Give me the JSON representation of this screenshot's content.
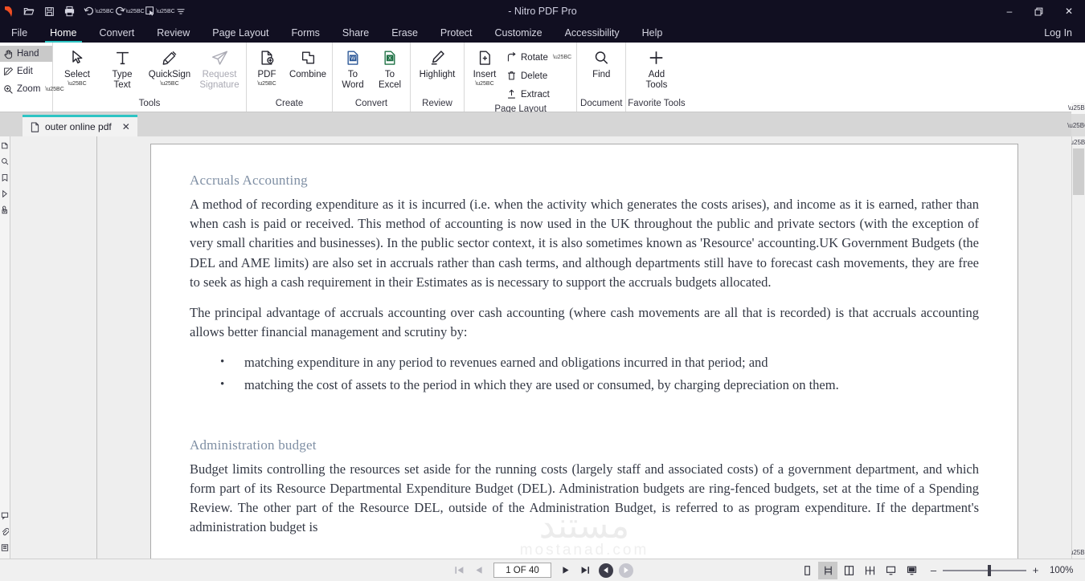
{
  "window": {
    "title": "- Nitro PDF Pro",
    "controls": {
      "minimize": "–",
      "restore": "❐",
      "close": "✕"
    },
    "quick_access": [
      "open-icon",
      "save-icon",
      "print-icon",
      "undo-icon",
      "redo-icon",
      "tool-icon",
      "customize-qat-icon"
    ]
  },
  "menubar": {
    "items": [
      {
        "label": "File",
        "active": false
      },
      {
        "label": "Home",
        "active": true
      },
      {
        "label": "Convert",
        "active": false
      },
      {
        "label": "Review",
        "active": false
      },
      {
        "label": "Page Layout",
        "active": false
      },
      {
        "label": "Forms",
        "active": false
      },
      {
        "label": "Share",
        "active": false
      },
      {
        "label": "Erase",
        "active": false
      },
      {
        "label": "Protect",
        "active": false
      },
      {
        "label": "Customize",
        "active": false
      },
      {
        "label": "Accessibility",
        "active": false
      },
      {
        "label": "Help",
        "active": false
      }
    ],
    "login_label": "Log In"
  },
  "ribbon": {
    "modes": [
      {
        "label": "Hand",
        "selected": true
      },
      {
        "label": "Edit",
        "selected": false
      },
      {
        "label": "Zoom",
        "selected": false,
        "dropdown": true
      }
    ],
    "groups": [
      {
        "label": "Tools",
        "buttons": [
          {
            "label": "Select",
            "dropdown": true,
            "disabled": false
          },
          {
            "label": "Type\nText",
            "line1": "Type",
            "line2": "Text",
            "dropdown": false,
            "disabled": false
          },
          {
            "label": "QuickSign",
            "dropdown": true,
            "disabled": false
          },
          {
            "label": "Request Signature",
            "line1": "Request",
            "line2": "Signature",
            "dropdown": false,
            "disabled": true
          }
        ]
      },
      {
        "label": "Create",
        "buttons": [
          {
            "label": "PDF",
            "dropdown": true,
            "disabled": false
          },
          {
            "label": "Combine",
            "dropdown": false,
            "disabled": false
          }
        ]
      },
      {
        "label": "Convert",
        "buttons": [
          {
            "label": "To Word",
            "line1": "To",
            "line2": "Word",
            "dropdown": false,
            "disabled": false
          },
          {
            "label": "To Excel",
            "line1": "To",
            "line2": "Excel",
            "dropdown": false,
            "disabled": false
          }
        ]
      },
      {
        "label": "Review",
        "buttons": [
          {
            "label": "Highlight",
            "dropdown": false,
            "disabled": false
          }
        ]
      },
      {
        "label": "Page Layout",
        "buttons": [
          {
            "label": "Insert",
            "dropdown": true,
            "disabled": false
          }
        ],
        "stacked": [
          {
            "label": "Rotate",
            "dropdown": true
          },
          {
            "label": "Delete",
            "dropdown": false
          },
          {
            "label": "Extract",
            "dropdown": false
          }
        ]
      },
      {
        "label": "Document",
        "buttons": [
          {
            "label": "Find",
            "dropdown": false,
            "disabled": false
          }
        ]
      },
      {
        "label": "Favorite Tools",
        "buttons": [
          {
            "label": "Add Tools",
            "line1": "Add",
            "line2": "Tools",
            "dropdown": false,
            "disabled": false
          }
        ]
      }
    ]
  },
  "tabstrip": {
    "tabs": [
      {
        "name": "outer online pdf",
        "close": "✕",
        "active": true
      }
    ],
    "overflow_caret": "▼"
  },
  "sidebar": {
    "top_icons": [
      "page-thumbnails-icon",
      "search-icon",
      "bookmarks-icon",
      "chevron-right-icon",
      "attachments-icon"
    ],
    "bottom_icons": [
      "comments-icon",
      "paperclip-icon",
      "layers-icon"
    ]
  },
  "document": {
    "watermark_line1": "مستند",
    "watermark_line2": "mostanad.com",
    "sections": [
      {
        "heading": "Accruals Accounting",
        "paragraphs": [
          "A method of recording expenditure as it is incurred (i.e. when the activity which generates the costs arises), and income as it is earned, rather than when cash is paid or received. This method of accounting is now used in the UK throughout the public and private sectors (with the exception of very small charities and businesses). In the public sector context, it is also sometimes known as 'Resource' accounting.UK Government Budgets (the DEL and AME limits) are also set in accruals rather than cash terms, and although departments still have to forecast cash movements, they are free to seek as high a cash requirement in their Estimates as is necessary to support the accruals budgets allocated.",
          "The principal advantage of accruals accounting over cash accounting (where cash movements are all that is recorded) is that accruals accounting allows better financial  management and scrutiny by:"
        ],
        "bullets": [
          "matching expenditure in any period to revenues earned and obligations incurred in that period; and",
          "matching the cost of assets to the period in which they are used or consumed, by charging depreciation on them."
        ]
      },
      {
        "heading": "Administration budget",
        "paragraphs": [
          "Budget limits controlling the resources set aside for the running costs (largely staff and associated costs) of a government department, and which form part of its Resource Departmental Expenditure Budget (DEL). Administration budgets are ring-fenced budgets, set at the time of a Spending Review. The other part of the Resource DEL, outside of the Administration Budget, is referred to as program expenditure. If the department's administration budget is"
        ],
        "bullets": []
      }
    ]
  },
  "statusbar": {
    "nav": {
      "first": "first-page-icon",
      "prev": "previous-page-icon",
      "page_value": "1 OF 40",
      "next": "next-page-icon",
      "last": "last-page-icon",
      "back": "navigate-back-icon",
      "forward": "navigate-forward-icon"
    },
    "view_modes": [
      {
        "name": "single-page-view",
        "selected": false
      },
      {
        "name": "continuous-page-view",
        "selected": true
      },
      {
        "name": "two-page-view",
        "selected": false
      },
      {
        "name": "two-page-continuous-view",
        "selected": false
      },
      {
        "name": "fit-page-view",
        "selected": false
      },
      {
        "name": "presentation-view",
        "selected": false
      }
    ],
    "zoom": {
      "minus": "–",
      "plus": "+",
      "level": "100%"
    }
  },
  "colors": {
    "titlebar": "#110f21",
    "accent_teal": "#2ec4c4",
    "heading_blue": "#7f8fa4",
    "word_blue": "#2b5797",
    "excel_green": "#1e7145"
  }
}
